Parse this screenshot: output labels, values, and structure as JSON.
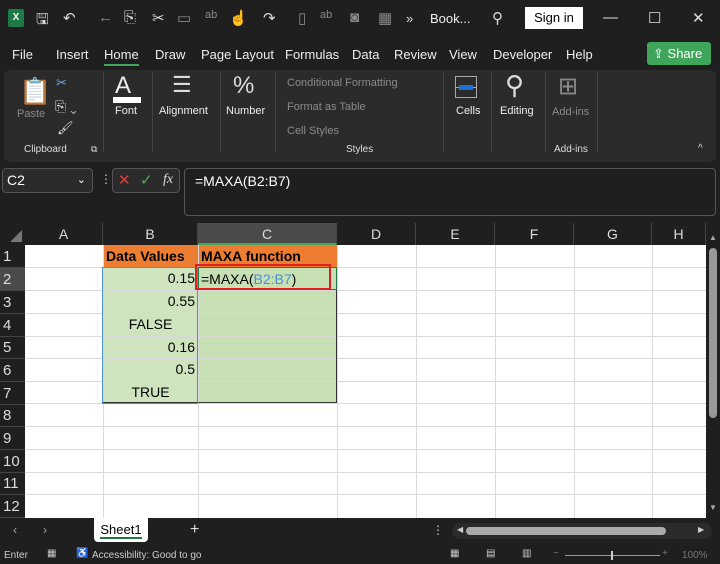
{
  "titlebar": {
    "title": "Book...",
    "sign_in": "Sign in",
    "more": "»"
  },
  "menu": [
    "File",
    "Insert",
    "Home",
    "Draw",
    "Page Layout",
    "Formulas",
    "Data",
    "Review",
    "View",
    "Developer",
    "Help"
  ],
  "share": "Share",
  "ribbon": {
    "paste": "Paste",
    "clipboard": "Clipboard",
    "font": "Font",
    "alignment": "Alignment",
    "number": "Number",
    "conditional_formatting": "Conditional Formatting",
    "format_as_table": "Format as Table",
    "cell_styles": "Cell Styles",
    "styles": "Styles",
    "cells": "Cells",
    "editing": "Editing",
    "addins_btn": "Add-ins",
    "addins_group": "Add-ins"
  },
  "formula_bar": {
    "name_box": "C2",
    "formula": "=MAXA(B2:B7)",
    "fx": "fx"
  },
  "columns": [
    "A",
    "B",
    "C",
    "D",
    "E",
    "F",
    "G",
    "H"
  ],
  "rows": [
    "1",
    "2",
    "3",
    "4",
    "5",
    "6",
    "7",
    "8",
    "9",
    "10",
    "11",
    "12"
  ],
  "cells": {
    "B1": "Data Values",
    "C1": "MAXA function",
    "B2": "0.15",
    "B3": "0.55",
    "B4": "FALSE",
    "B5": "0.16",
    "B6": "0.5",
    "B7": "TRUE",
    "C2_prefix": "=MAXA(",
    "C2_ref": "B2:B7",
    "C2_suffix": ")"
  },
  "sheet_tab": "Sheet1",
  "status": {
    "mode": "Enter",
    "accessibility": "Accessibility: Good to go",
    "zoom": "100%"
  },
  "colors": {
    "header_fill": "#ed7d31",
    "data_fill": "#c6dfb4",
    "green_accent": "#3fa55b",
    "ref_blue": "#4a90d9",
    "highlight_red": "#e02020"
  }
}
